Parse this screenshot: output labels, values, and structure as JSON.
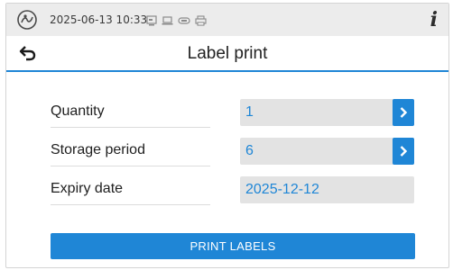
{
  "status_bar": {
    "datetime": "2025-06-13 10:33",
    "icons": [
      "logo-icon",
      "card-reader-icon",
      "laptop-icon",
      "network-adapter-icon",
      "printer-icon",
      "info-icon"
    ],
    "info_glyph": "i"
  },
  "header": {
    "title": "Label print",
    "back_icon": "back-arrow-icon"
  },
  "form": {
    "quantity": {
      "label": "Quantity",
      "value": "1"
    },
    "storage_period": {
      "label": "Storage period",
      "value": "6"
    },
    "expiry_date": {
      "label": "Expiry date",
      "value": "2025-12-12"
    }
  },
  "actions": {
    "print_label": "PRINT LABELS"
  },
  "colors": {
    "accent": "#1f86d6",
    "status_bar_bg": "#ececec",
    "field_bg": "#e3e3e3"
  }
}
